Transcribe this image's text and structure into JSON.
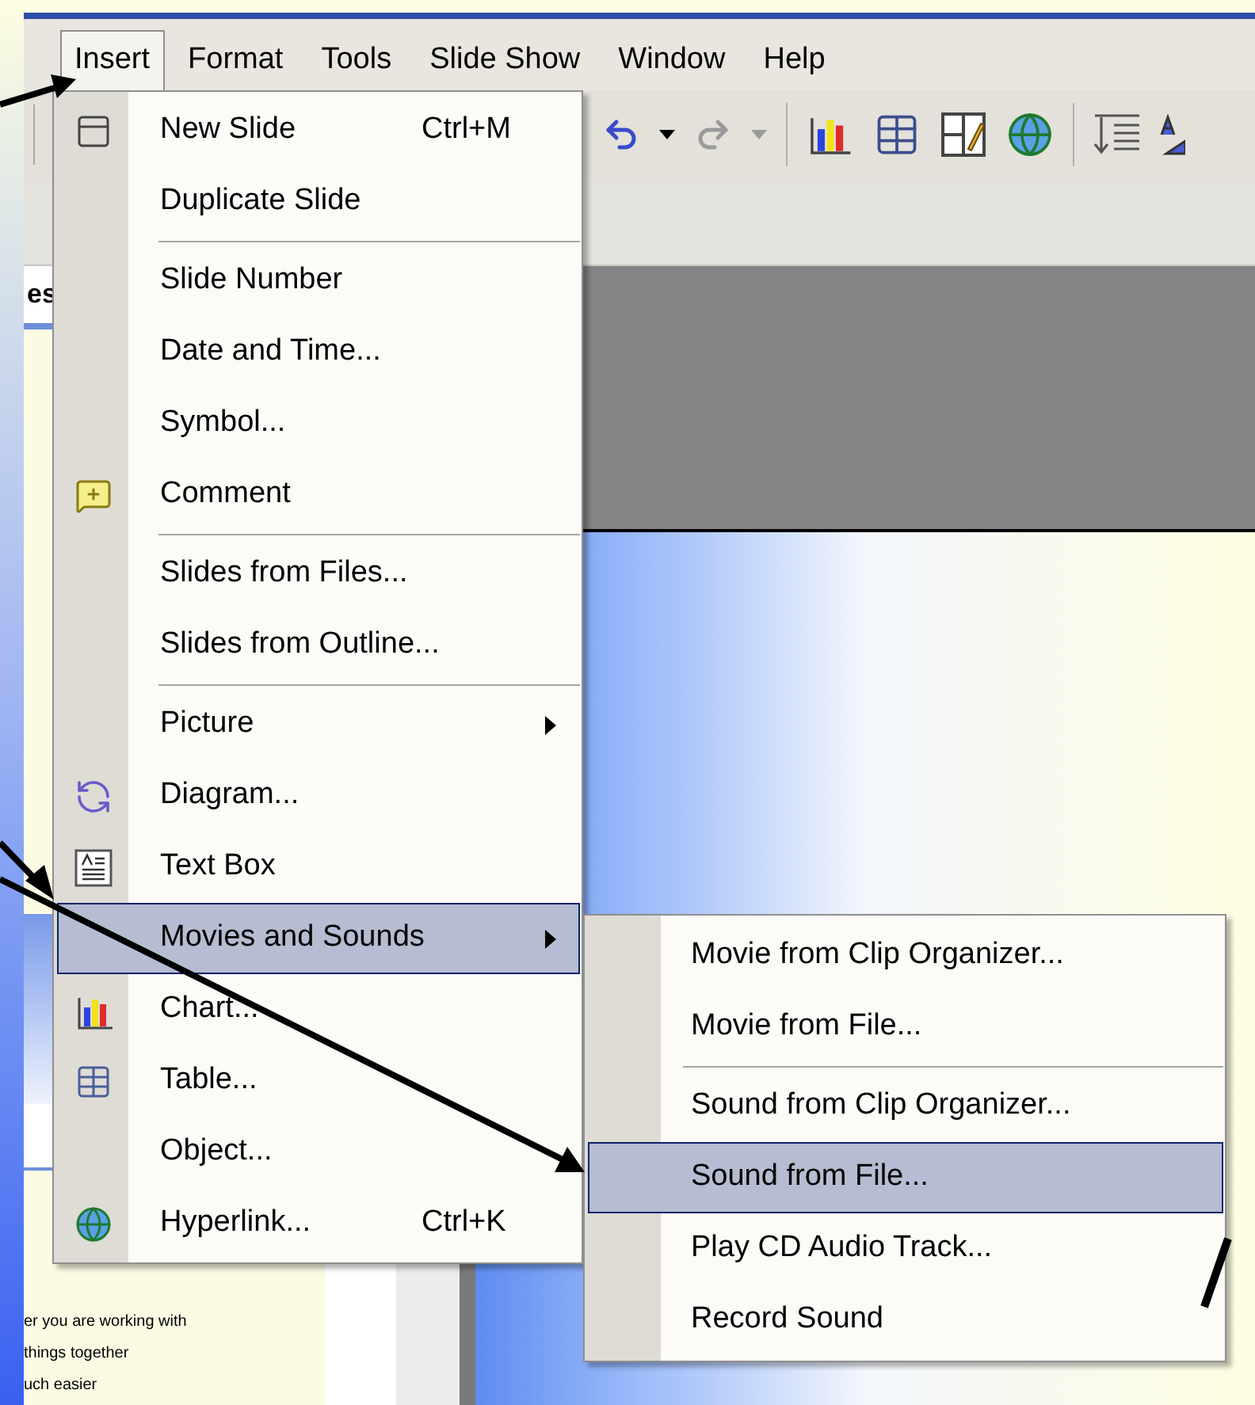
{
  "menu_bar": [
    {
      "label": "Insert",
      "selected": true
    },
    {
      "label": "Format",
      "selected": false
    },
    {
      "label": "Tools",
      "selected": false
    },
    {
      "label": "Slide Show",
      "selected": false
    },
    {
      "label": "Window",
      "selected": false
    },
    {
      "label": "Help",
      "selected": false
    }
  ],
  "side_pane": {
    "tab": "es",
    "text_lines": [
      "er you are working with",
      "things together",
      "uch easier"
    ]
  },
  "insert_menu": [
    {
      "label": "New Slide",
      "shortcut": "Ctrl+M",
      "kind": "item",
      "selected": false,
      "separator_after": false
    },
    {
      "label": "Duplicate Slide",
      "kind": "item",
      "selected": false,
      "separator_after": true
    },
    {
      "label": "Slide Number",
      "kind": "item",
      "selected": false,
      "separator_after": false
    },
    {
      "label": "Date and Time...",
      "kind": "item",
      "selected": false,
      "separator_after": false
    },
    {
      "label": "Symbol...",
      "kind": "item",
      "selected": false,
      "separator_after": false
    },
    {
      "label": "Comment",
      "kind": "item",
      "selected": false,
      "separator_after": true
    },
    {
      "label": "Slides from Files...",
      "kind": "item",
      "selected": false,
      "separator_after": false
    },
    {
      "label": "Slides from Outline...",
      "kind": "item",
      "selected": false,
      "separator_after": true
    },
    {
      "label": "Picture",
      "kind": "submenu",
      "selected": false,
      "separator_after": false
    },
    {
      "label": "Diagram...",
      "kind": "item",
      "selected": false,
      "separator_after": false
    },
    {
      "label": "Text Box",
      "kind": "item",
      "selected": false,
      "separator_after": false
    },
    {
      "label": "Movies and Sounds",
      "kind": "submenu",
      "selected": true,
      "separator_after": false
    },
    {
      "label": "Chart...",
      "kind": "item",
      "selected": false,
      "separator_after": false
    },
    {
      "label": "Table...",
      "kind": "item",
      "selected": false,
      "separator_after": false
    },
    {
      "label": "Object...",
      "kind": "item",
      "selected": false,
      "separator_after": false
    },
    {
      "label": "Hyperlink...",
      "shortcut": "Ctrl+K",
      "kind": "item",
      "selected": false,
      "separator_after": false
    }
  ],
  "movies_and_sounds_menu": [
    {
      "label": "Movie from Clip Organizer...",
      "selected": false,
      "separator_after": false
    },
    {
      "label": "Movie from File...",
      "selected": false,
      "separator_after": true
    },
    {
      "label": "Sound from Clip Organizer...",
      "selected": false,
      "separator_after": false
    },
    {
      "label": "Sound from File...",
      "selected": true,
      "separator_after": false
    },
    {
      "label": "Play CD Audio Track...",
      "selected": false,
      "separator_after": false
    },
    {
      "label": "Record Sound",
      "selected": false,
      "separator_after": false
    }
  ]
}
